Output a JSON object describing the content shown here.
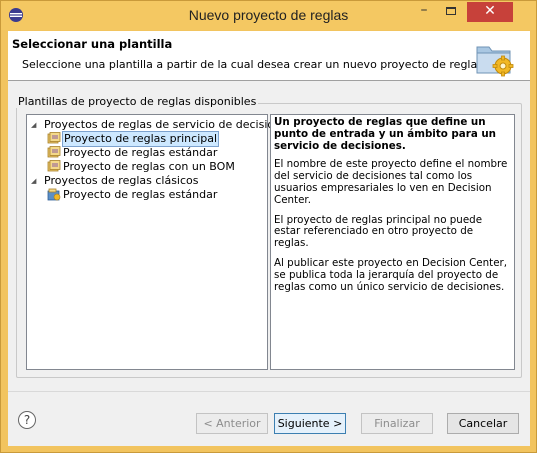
{
  "window": {
    "title": "Nuevo proyecto de reglas",
    "min_glyph": "–",
    "close_glyph": "✕"
  },
  "header": {
    "title": "Seleccionar una plantilla",
    "description": "Seleccione una plantilla a partir de la cual desea crear un nuevo proyecto de reglas."
  },
  "group": {
    "label": "Plantillas de proyecto de reglas disponibles"
  },
  "tree": {
    "categories": [
      {
        "label": "Proyectos de reglas de servicio de decisiones",
        "expanded": true,
        "items": [
          {
            "label": "Proyecto de reglas principal",
            "selected": true
          },
          {
            "label": "Proyecto de reglas estándar",
            "selected": false
          },
          {
            "label": "Proyecto de reglas con un BOM",
            "selected": false
          }
        ]
      },
      {
        "label": "Proyectos de reglas clásicos",
        "expanded": true,
        "items": [
          {
            "label": "Proyecto de reglas estándar",
            "selected": false
          }
        ]
      }
    ]
  },
  "description": {
    "lead": "Un proyecto de reglas que define un punto de entrada y un ámbito para un servicio de decisiones.",
    "paragraphs": [
      "El nombre de este proyecto define el nombre del servicio de decisiones tal como los usuarios empresariales lo ven en Decision Center.",
      "El proyecto de reglas principal no puede estar referenciado en otro proyecto de reglas.",
      "Al publicar este proyecto en Decision Center, se publica toda la jerarquía del proyecto de reglas como un único servicio de decisiones."
    ]
  },
  "buttons": {
    "help": "?",
    "back": "< Anterior",
    "next": "Siguiente >",
    "finish": "Finalizar",
    "cancel": "Cancelar"
  },
  "colors": {
    "titlebar": "#f4c862",
    "close": "#c7413a",
    "selection": "#cde8ff"
  }
}
